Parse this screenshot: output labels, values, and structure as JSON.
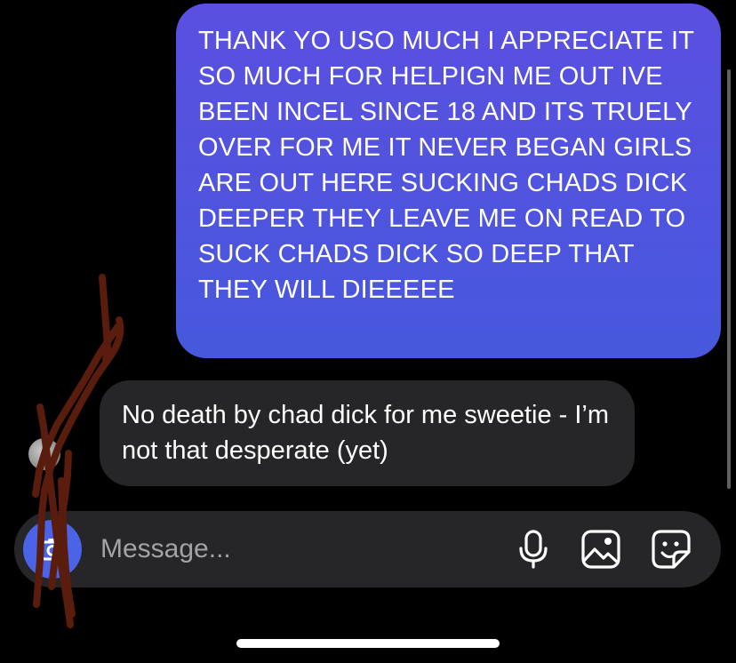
{
  "colors": {
    "outgoing_bubble_top": "#5a4fe0",
    "outgoing_bubble_bottom": "#4758dd",
    "incoming_bubble": "#262628",
    "camera_button": "#4b63e6",
    "scribble": "#5a1c0c"
  },
  "conversation": {
    "messages": [
      {
        "direction": "outgoing",
        "text": "THANK YO USO MUCH I APPRECIATE IT SO MUCH FOR HELPIGN ME OUT IVE BEEN INCEL SINCE 18 AND ITS TRUELY OVER FOR ME IT NEVER BEGAN GIRLS ARE OUT HERE SUCKING CHADS DICK DEEPER THEY LEAVE ME ON READ TO SUCK CHADS DICK SO DEEP THAT THEY WILL DIEEEEE"
      },
      {
        "direction": "incoming",
        "text": "No death by chad dick for me sweetie - I’m not that desperate (yet)"
      }
    ]
  },
  "composer": {
    "placeholder": "Message...",
    "icons": {
      "camera": "camera-icon",
      "mic": "microphone-icon",
      "gallery": "image-icon",
      "sticker": "sticker-icon"
    }
  }
}
